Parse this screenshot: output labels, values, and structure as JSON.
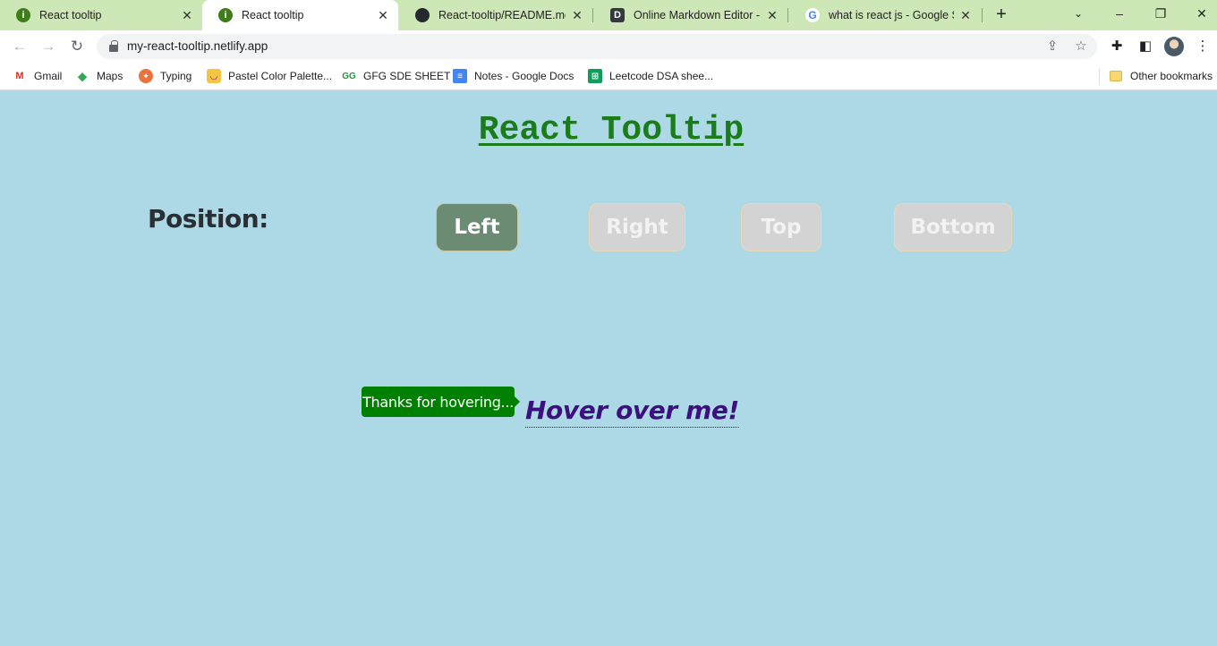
{
  "browser": {
    "tabs": [
      {
        "title": "React tooltip",
        "icon": "info-favicon",
        "active": false
      },
      {
        "title": "React tooltip",
        "icon": "info-favicon",
        "active": true
      },
      {
        "title": "React-tooltip/README.md at",
        "icon": "github-icon",
        "active": false
      },
      {
        "title": "Online Markdown Editor - Di",
        "icon": "dillinger-icon",
        "active": false
      },
      {
        "title": "what is react js - Google Sear",
        "icon": "google-icon",
        "active": false
      }
    ],
    "close_glyph": "✕",
    "new_tab_glyph": "+",
    "url": "my-react-tooltip.netlify.app",
    "bookmarks": [
      {
        "label": "Gmail",
        "icon": "gmail-icon"
      },
      {
        "label": "Maps",
        "icon": "maps-icon"
      },
      {
        "label": "Typing",
        "icon": "typing-icon"
      },
      {
        "label": "Pastel Color Palette...",
        "icon": "palette-icon"
      },
      {
        "label": "GFG SDE SHEET",
        "icon": "gfg-icon"
      },
      {
        "label": "Notes - Google Docs",
        "icon": "docs-icon"
      },
      {
        "label": "Leetcode DSA shee...",
        "icon": "sheets-icon"
      }
    ],
    "other_bookmarks": "Other bookmarks"
  },
  "page": {
    "title": "React Tooltip",
    "position_label": "Position:",
    "buttons": [
      {
        "label": "Left",
        "active": true
      },
      {
        "label": "Right",
        "active": false
      },
      {
        "label": "Top",
        "active": false
      },
      {
        "label": "Bottom",
        "active": false
      }
    ],
    "tooltip_text": "Thanks for hovering...",
    "hover_text": "Hover over me!"
  },
  "colors": {
    "page_background": "#add8e6",
    "title_green": "#1a7d1a",
    "tooltip_background": "#008000",
    "active_button": "#6b8b73",
    "inactive_button": "#d3d3d3",
    "hover_text": "#3d1080",
    "tabstrip": "#cde8b6"
  }
}
